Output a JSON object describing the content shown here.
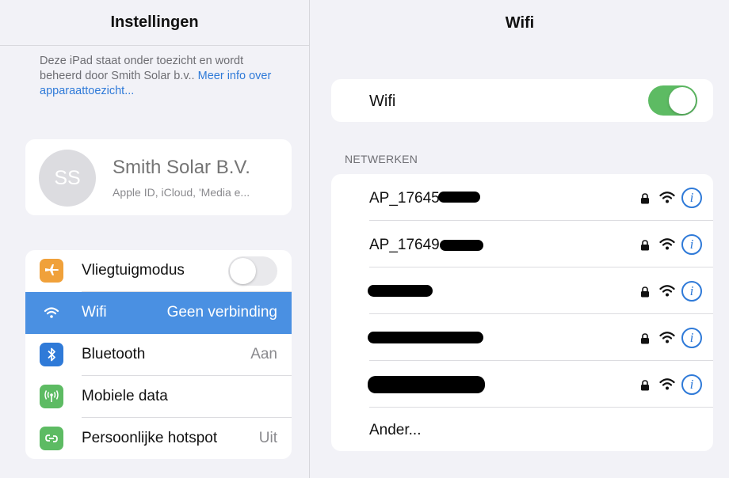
{
  "left": {
    "title": "Instellingen",
    "supervision_text": "Deze iPad staat onder toezicht en wordt beheerd door Smith Solar b.v.. ",
    "supervision_link": "Meer info over apparaattoezicht...",
    "profile": {
      "initials": "SS",
      "name": "Smith Solar B.V.",
      "subtitle": "Apple ID, iCloud, 'Media e..."
    },
    "settings": [
      {
        "label": "Vliegtuigmodus",
        "value": "",
        "icon": "airplane-icon",
        "color": "#f0a13a"
      },
      {
        "label": "Wifi",
        "value": "Geen verbinding",
        "icon": "wifi-icon",
        "color": "#4a90e2"
      },
      {
        "label": "Bluetooth",
        "value": "Aan",
        "icon": "bluetooth-icon",
        "color": "#2f7ad8"
      },
      {
        "label": "Mobiele data",
        "value": "",
        "icon": "antenna-icon",
        "color": "#5dbb63"
      },
      {
        "label": "Persoonlijke hotspot",
        "value": "Uit",
        "icon": "hotspot-icon",
        "color": "#5dbb63"
      }
    ]
  },
  "right": {
    "title": "Wifi",
    "wifi_label": "Wifi",
    "wifi_enabled": true,
    "section_header": "NETWERKEN",
    "networks": [
      {
        "name": "AP_17645"
      },
      {
        "name": "AP_17649"
      },
      {
        "name": ""
      },
      {
        "name": ""
      },
      {
        "name": ""
      }
    ],
    "other_label": "Ander..."
  }
}
